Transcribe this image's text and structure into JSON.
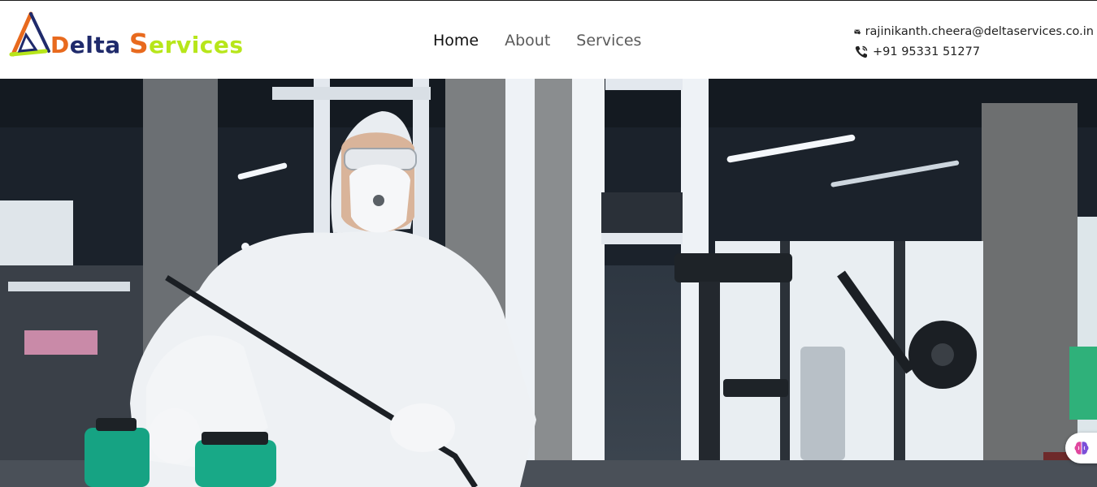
{
  "brand": {
    "name_part1_initial": "D",
    "name_part1_rest": "elta ",
    "name_part2_initial": "S",
    "name_part2_rest": "ervices",
    "colors": {
      "orange": "#e86a1e",
      "navy": "#1f2a6b",
      "lime": "#b7e61a"
    }
  },
  "nav": {
    "items": [
      {
        "label": "Home",
        "active": true
      },
      {
        "label": "About",
        "active": false
      },
      {
        "label": "Services",
        "active": false
      }
    ]
  },
  "contact": {
    "email": "rajinikanth.cheera@deltaservices.co.in",
    "email_icon": "mail-icon",
    "phone": "+91 95331 51277",
    "phone_icon": "phone-icon"
  },
  "hero": {
    "image": "worker-in-protective-suit-disinfecting-gym"
  },
  "widget": {
    "icon": "brain-icon"
  }
}
